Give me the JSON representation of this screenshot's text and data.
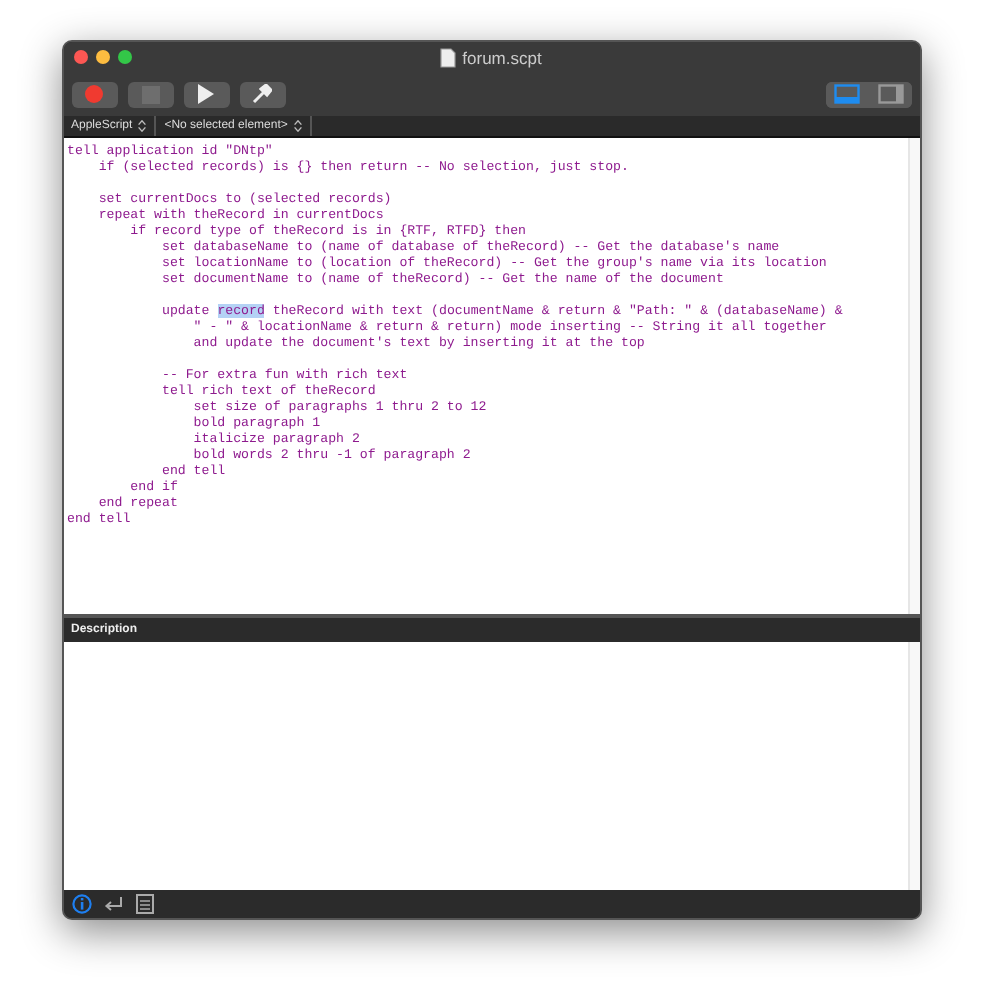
{
  "window": {
    "title": "forum.scpt"
  },
  "toolbar": {
    "view_buttons": [
      {
        "kind": "bottom-pane",
        "selected": true
      },
      {
        "kind": "side-pane",
        "selected": false
      }
    ]
  },
  "navigation_bar": {
    "language": "AppleScript",
    "element": "<No selected element>"
  },
  "code_lines": [
    {
      "kind": "code",
      "text": "tell application id \"DNtp\""
    },
    {
      "kind": "code",
      "text": "    if (selected records) is {} then return -- No selection, just stop."
    },
    {
      "kind": "blank"
    },
    {
      "kind": "code",
      "text": "    set currentDocs to (selected records)"
    },
    {
      "kind": "code",
      "text": "    repeat with theRecord in currentDocs"
    },
    {
      "kind": "code",
      "text": "        if record type of theRecord is in {RTF, RTFD} then"
    },
    {
      "kind": "code",
      "text": "            set databaseName to (name of database of theRecord) -- Get the database's name"
    },
    {
      "kind": "code",
      "text": "            set locationName to (location of theRecord) -- Get the group's name via its location"
    },
    {
      "kind": "code",
      "text": "            set documentName to (name of theRecord) -- Get the name of the document"
    },
    {
      "kind": "blank"
    },
    {
      "kind": "selection",
      "before": "            update ",
      "selected": "record",
      "after": " theRecord with text (documentName & return & \"Path: \" & (databaseName) &"
    },
    {
      "kind": "code",
      "text": "                \" - \" & locationName & return & return) mode inserting -- String it all together"
    },
    {
      "kind": "code",
      "text": "                and update the document's text by inserting it at the top"
    },
    {
      "kind": "blank"
    },
    {
      "kind": "code",
      "text": "            -- For extra fun with rich text"
    },
    {
      "kind": "code",
      "text": "            tell rich text of theRecord"
    },
    {
      "kind": "code",
      "text": "                set size of paragraphs 1 thru 2 to 12"
    },
    {
      "kind": "code",
      "text": "                bold paragraph 1"
    },
    {
      "kind": "code",
      "text": "                italicize paragraph 2"
    },
    {
      "kind": "code",
      "text": "                bold words 2 thru -1 of paragraph 2"
    },
    {
      "kind": "code",
      "text": "            end tell"
    },
    {
      "kind": "code",
      "text": "        end if"
    },
    {
      "kind": "code",
      "text": "    end repeat"
    },
    {
      "kind": "code",
      "text": "end tell"
    }
  ],
  "description_pane": {
    "title": "Description"
  },
  "bottom_bar": {
    "tabs": [
      {
        "kind": "info",
        "selected": true
      },
      {
        "kind": "replies",
        "selected": false
      },
      {
        "kind": "log",
        "selected": false
      }
    ]
  }
}
